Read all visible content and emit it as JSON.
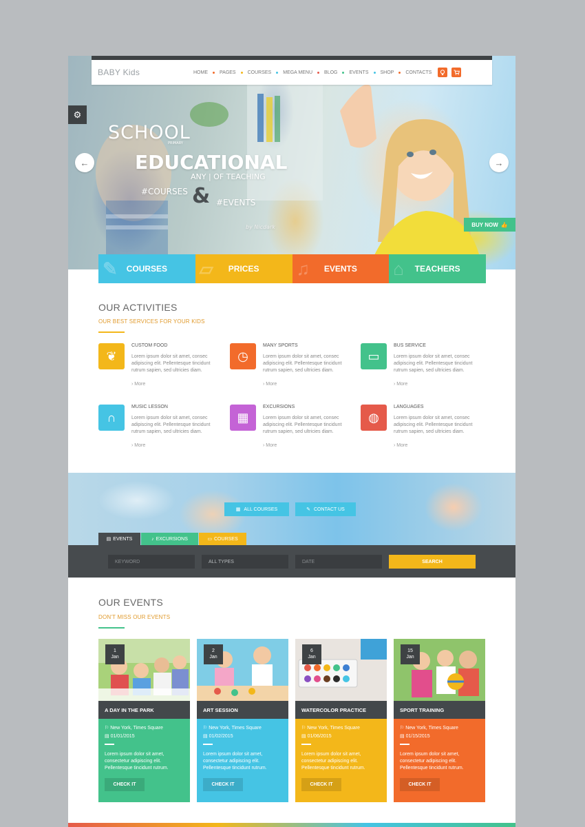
{
  "nav": {
    "logo": "BABY Kids",
    "items": [
      {
        "label": "HOME",
        "dot": "#f26b2b"
      },
      {
        "label": "PAGES",
        "dot": "#f3b71a"
      },
      {
        "label": "COURSES",
        "dot": "#45c4e4"
      },
      {
        "label": "MEGA MENU",
        "dot": "#e55a4a"
      },
      {
        "label": "BLOG",
        "dot": "#43c28b"
      },
      {
        "label": "EVENTS",
        "dot": "#45c4e4"
      },
      {
        "label": "SHOP",
        "dot": "#f26b2b"
      },
      {
        "label": "CONTACTS",
        "dot": ""
      }
    ],
    "icons": [
      "lightbulb-icon",
      "cart-icon"
    ]
  },
  "hero": {
    "line1": "SCHOOL",
    "line1_small": "PRIMARY",
    "line2": "EDUCATIONAL",
    "line3": "ANY | OF TEACHING",
    "courses": "#COURSES",
    "amp": "&",
    "events": "#EVENTS",
    "signature": "by Nicdark",
    "buy_now": "BUY NOW"
  },
  "tiles": [
    {
      "label": "COURSES",
      "color": "#45c4e4",
      "icon": "pencil-icon"
    },
    {
      "label": "PRICES",
      "color": "#f3b71a",
      "icon": "ticket-icon"
    },
    {
      "label": "EVENTS",
      "color": "#f26b2b",
      "icon": "music-icon"
    },
    {
      "label": "TEACHERS",
      "color": "#43c28b",
      "icon": "graduation-cap-icon"
    }
  ],
  "activities": {
    "title": "OUR ACTIVITIES",
    "subtitle": "OUR BEST SERVICES FOR YOUR KIDS",
    "items": [
      {
        "title": "CUSTOM FOOD",
        "color": "#f3b71a",
        "icon": "leaf-icon",
        "text": "Lorem ipsum dolor sit amet, consec adipiscing elit. Pellentesque tincidunt rutrum sapien, sed ultricies diam.",
        "more": "More"
      },
      {
        "title": "MANY SPORTS",
        "color": "#f26b2b",
        "icon": "stopwatch-icon",
        "text": "Lorem ipsum dolor sit amet, consec adipiscing elit. Pellentesque tincidunt rutrum sapien, sed ultricies diam.",
        "more": "More"
      },
      {
        "title": "BUS SERVICE",
        "color": "#43c28b",
        "icon": "bus-icon",
        "text": "Lorem ipsum dolor sit amet, consec adipiscing elit. Pellentesque tincidunt rutrum sapien, sed ultricies diam.",
        "more": "More"
      },
      {
        "title": "MUSIC LESSON",
        "color": "#45c4e4",
        "icon": "headphones-icon",
        "text": "Lorem ipsum dolor sit amet, consec adipiscing elit. Pellentesque tincidunt rutrum sapien, sed ultricies diam.",
        "more": "More"
      },
      {
        "title": "EXCURSIONS",
        "color": "#c463d6",
        "icon": "map-icon",
        "text": "Lorem ipsum dolor sit amet, consec adipiscing elit. Pellentesque tincidunt rutrum sapien, sed ultricies diam.",
        "more": "More"
      },
      {
        "title": "LANGUAGES",
        "color": "#e55a4a",
        "icon": "globe-icon",
        "text": "Lorem ipsum dolor sit amet, consec adipiscing elit. Pellentesque tincidunt rutrum sapien, sed ultricies diam.",
        "more": "More"
      }
    ]
  },
  "band": {
    "all_courses": "ALL COURSES",
    "contact_us": "CONTACT US"
  },
  "search": {
    "tabs": [
      {
        "label": "EVENTS",
        "color": "#474b4e",
        "icon": "calendar-icon"
      },
      {
        "label": "EXCURSIONS",
        "color": "#43c28b",
        "icon": "bell-icon"
      },
      {
        "label": "COURSES",
        "color": "#f3b71a",
        "icon": "chat-icon"
      }
    ],
    "keyword_placeholder": "KEYWORD",
    "type_value": "ALL TYPES",
    "date_placeholder": "DATE",
    "button": "SEARCH"
  },
  "events": {
    "title": "OUR EVENTS",
    "subtitle": "DON'T MISS OUR EVENTS",
    "items": [
      {
        "day": "1",
        "month": "Jan",
        "title": "A DAY IN THE PARK",
        "location": "New York, Times Square",
        "date": "01/01/2015",
        "text": "Lorem ipsum dolor sit amet, consectetur adipiscing elit. Pellentesque tincidunt rutrum.",
        "button": "CHECK IT",
        "color": "#43c28b"
      },
      {
        "day": "2",
        "month": "Jan",
        "title": "ART SESSION",
        "location": "New York, Times Square",
        "date": "01/02/2015",
        "text": "Lorem ipsum dolor sit amet, consectetur adipiscing elit. Pellentesque tincidunt rutrum.",
        "button": "CHECK IT",
        "color": "#45c4e4"
      },
      {
        "day": "6",
        "month": "Jan",
        "title": "WATERCOLOR PRACTICE",
        "location": "New York, Times Square",
        "date": "01/06/2015",
        "text": "Lorem ipsum dolor sit amet, consectetur adipiscing elit. Pellentesque tincidunt rutrum.",
        "button": "CHECK IT",
        "color": "#f3b71a"
      },
      {
        "day": "15",
        "month": "Jan",
        "title": "SPORT TRAINING",
        "location": "New York, Times Square",
        "date": "01/15/2015",
        "text": "Lorem ipsum dolor sit amet, consectetur adipiscing elit. Pellentesque tincidunt rutrum.",
        "button": "CHECK IT",
        "color": "#f26b2b"
      }
    ]
  }
}
